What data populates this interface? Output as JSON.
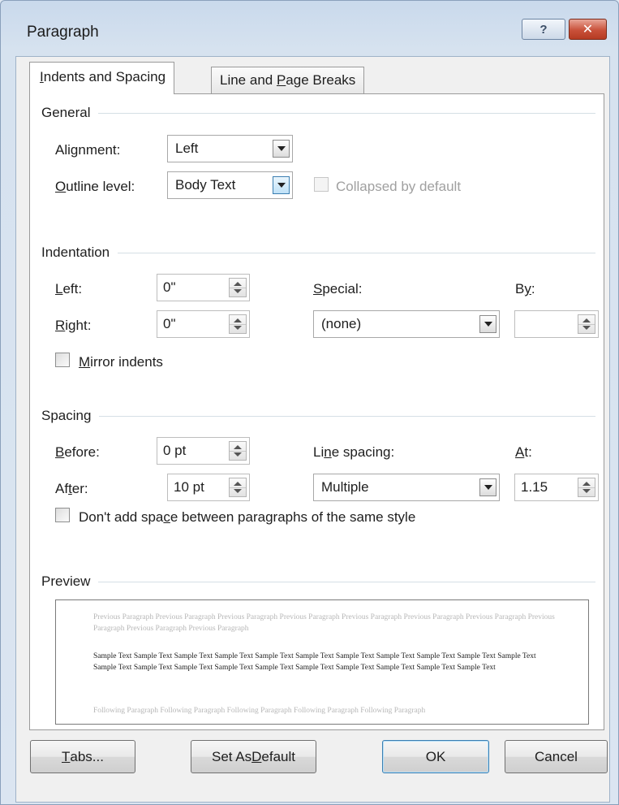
{
  "window": {
    "title": "Paragraph",
    "help_icon": "?",
    "close_icon": "✕"
  },
  "tabs": [
    {
      "pre": "",
      "key": "I",
      "post": "ndents and Spacing",
      "selected": true
    },
    {
      "pre": "Line and ",
      "key": "P",
      "post": "age Breaks",
      "selected": false
    }
  ],
  "general": {
    "header": "General",
    "alignment_label": {
      "pre": "Ali",
      "key": "g",
      "post": "nment:"
    },
    "alignment_value": "Left",
    "outline_label": {
      "pre": "",
      "key": "O",
      "post": "utline level:"
    },
    "outline_value": "Body Text",
    "collapsed_label": "Collapsed by default",
    "collapsed_checked": false
  },
  "indentation": {
    "header": "Indentation",
    "left_label": {
      "pre": "",
      "key": "L",
      "post": "eft:"
    },
    "left_value": "0\"",
    "right_label": {
      "pre": "",
      "key": "R",
      "post": "ight:"
    },
    "right_value": "0\"",
    "special_label": {
      "pre": "",
      "key": "S",
      "post": "pecial:"
    },
    "special_value": "(none)",
    "by_label": {
      "pre": "B",
      "key": "y",
      "post": ":"
    },
    "by_value": "",
    "mirror_label": {
      "pre": "",
      "key": "M",
      "post": "irror indents"
    },
    "mirror_checked": false
  },
  "spacing": {
    "header": "Spacing",
    "before_label": {
      "pre": "",
      "key": "B",
      "post": "efore:"
    },
    "before_value": "0 pt",
    "after_label": {
      "pre": "Af",
      "key": "t",
      "post": "er:"
    },
    "after_value": "10 pt",
    "line_spacing_label": {
      "pre": "Li",
      "key": "n",
      "post": "e spacing:"
    },
    "line_spacing_value": "Multiple",
    "at_label": {
      "pre": "",
      "key": "A",
      "post": "t:"
    },
    "at_value": "1.15",
    "dont_add_label": {
      "pre": "Don't add spa",
      "key": "c",
      "post": "e between paragraphs of the same style"
    },
    "dont_add_checked": false
  },
  "preview": {
    "header": "Preview",
    "previous_text": "Previous Paragraph Previous Paragraph Previous Paragraph Previous Paragraph Previous Paragraph Previous Paragraph Previous Paragraph Previous Paragraph Previous Paragraph Previous Paragraph",
    "sample_text": "Sample Text Sample Text Sample Text Sample Text Sample Text Sample Text Sample Text Sample Text Sample Text Sample Text Sample Text Sample Text Sample Text Sample Text Sample Text Sample Text Sample Text Sample Text Sample Text Sample Text Sample Text",
    "following_text": "Following Paragraph Following Paragraph Following Paragraph Following Paragraph Following Paragraph"
  },
  "buttons": {
    "tabs": {
      "pre": "",
      "key": "T",
      "post": "abs..."
    },
    "set_default": {
      "pre": "Set As ",
      "key": "D",
      "post": "efault"
    },
    "ok": "OK",
    "cancel": "Cancel"
  },
  "colors": {
    "accent": "#3c7fb1",
    "dialog_bg": "#f0f0f0",
    "close_red": "#c9513a"
  }
}
